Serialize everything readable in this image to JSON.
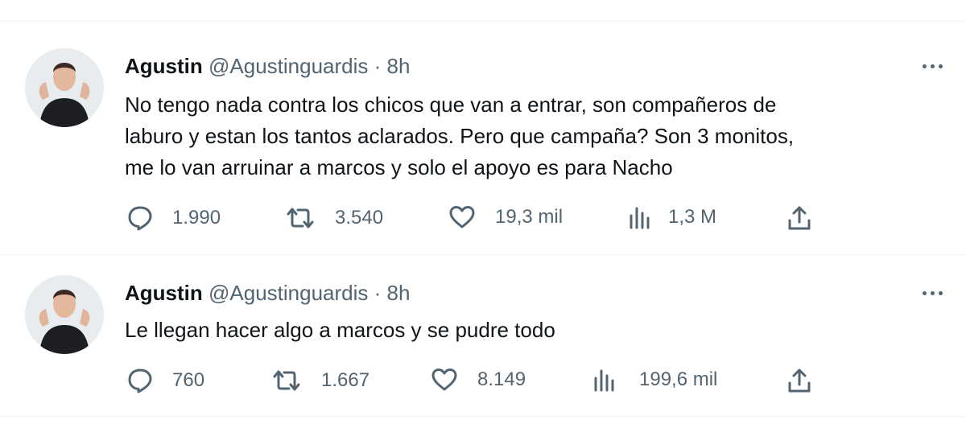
{
  "tweets": [
    {
      "name": "Agustin",
      "handle": "@Agustinguardis",
      "separator": "·",
      "time": "8h",
      "text_lines": [
        "No tengo nada contra los chicos que van a entrar, son compañeros de",
        "laburo y estan los tantos aclarados. Pero que campaña? Son 3 monitos,",
        "me lo van arruinar a marcos y solo el apoyo es para Nacho"
      ],
      "replies": "1.990",
      "retweets": "3.540",
      "likes": "19,3 mil",
      "views": "1,3 M"
    },
    {
      "name": "Agustin",
      "handle": "@Agustinguardis",
      "separator": "·",
      "time": "8h",
      "text_lines": [
        "Le llegan hacer algo a marcos y se pudre todo"
      ],
      "replies": "760",
      "retweets": "1.667",
      "likes": "8.149",
      "views": "199,6 mil"
    }
  ],
  "icons": {
    "reply": "reply-icon",
    "retweet": "retweet-icon",
    "like": "heart-icon",
    "views": "views-chart-icon",
    "share": "share-icon",
    "more": "more-icon"
  },
  "colors": {
    "text": "#0f1419",
    "secondary": "#536471",
    "divider": "#eff3f4"
  }
}
